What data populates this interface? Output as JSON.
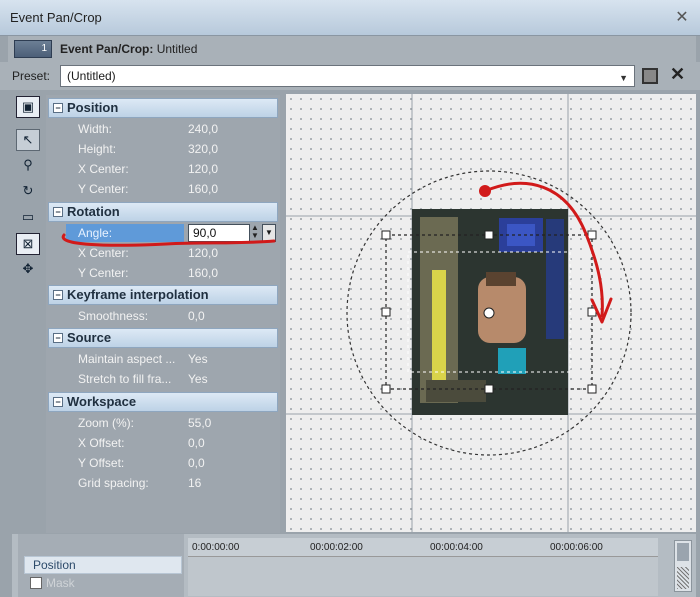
{
  "window": {
    "title": "Event Pan/Crop"
  },
  "header": {
    "title": "Event Pan/Crop:",
    "file": "Untitled",
    "icon_number": "1"
  },
  "preset": {
    "label": "Preset:",
    "value": "(Untitled)"
  },
  "sections": {
    "position": {
      "title": "Position",
      "rows": [
        {
          "label": "Width:",
          "value": "240,0"
        },
        {
          "label": "Height:",
          "value": "320,0"
        },
        {
          "label": "X Center:",
          "value": "120,0"
        },
        {
          "label": "Y Center:",
          "value": "160,0"
        }
      ]
    },
    "rotation": {
      "title": "Rotation",
      "angle_label": "Angle:",
      "angle_value": "90,0",
      "rows": [
        {
          "label": "X Center:",
          "value": "120,0"
        },
        {
          "label": "Y Center:",
          "value": "160,0"
        }
      ]
    },
    "keyframe": {
      "title": "Keyframe interpolation",
      "rows": [
        {
          "label": "Smoothness:",
          "value": "0,0"
        }
      ]
    },
    "source": {
      "title": "Source",
      "rows": [
        {
          "label": "Maintain aspect ...",
          "value": "Yes"
        },
        {
          "label": "Stretch to fill fra...",
          "value": "Yes"
        }
      ]
    },
    "workspace": {
      "title": "Workspace",
      "rows": [
        {
          "label": "Zoom (%):",
          "value": "55,0"
        },
        {
          "label": "X Offset:",
          "value": "0,0"
        },
        {
          "label": "Y Offset:",
          "value": "0,0"
        },
        {
          "label": "Grid spacing:",
          "value": "16"
        }
      ]
    }
  },
  "toolbar": {
    "icons": [
      "properties-toggle-icon",
      "pointer-icon",
      "zoom-icon",
      "rotate-icon",
      "frame-icon",
      "fit-icon",
      "move-icon"
    ]
  },
  "timeline": {
    "position_label": "Position",
    "mask_label": "Mask",
    "ticks": [
      "0:00:00:00",
      "00:00:02:00",
      "00:00:04:00",
      "00:00:06:00"
    ]
  },
  "colors": {
    "annotation": "#d11a1a",
    "section_header": "#cfe0f1",
    "highlight": "#5f9ad9"
  }
}
